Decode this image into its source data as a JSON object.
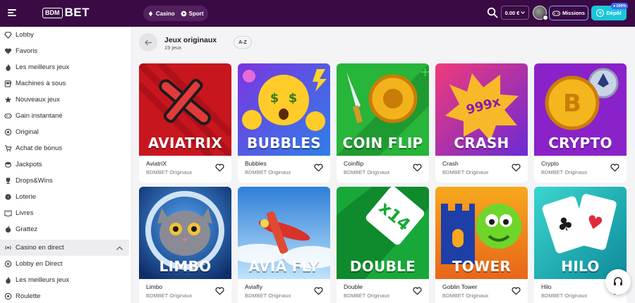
{
  "header": {
    "logo_box": "BDM",
    "logo_text": "BET",
    "switcher": [
      {
        "label": "Casino",
        "icon": "cards-icon"
      },
      {
        "label": "Sport",
        "icon": "soccer-ball-icon"
      }
    ],
    "balance": "0.00 €",
    "missions_label": "Missions",
    "deposit_label": "Dépôt",
    "deposit_badge": "100%",
    "colors": {
      "topbar": "#3a0a45",
      "deposit": "#19c7d9",
      "missions_border": "#8aa2ff"
    }
  },
  "sidebar": {
    "items": [
      {
        "label": "Lobby",
        "icon": "diamond-icon"
      },
      {
        "label": "Favoris",
        "icon": "heart-icon"
      },
      {
        "label": "Les meilleurs jeux",
        "icon": "fire-icon"
      },
      {
        "label": "Machines à sous",
        "icon": "slot-machine-icon"
      },
      {
        "label": "Nouveaux jeux",
        "icon": "star-icon"
      },
      {
        "label": "Gain instantané",
        "icon": "gamepad-icon"
      },
      {
        "label": "Original",
        "icon": "badge-icon"
      },
      {
        "label": "Achat de bonus",
        "icon": "cart-icon"
      },
      {
        "label": "Jackpots",
        "icon": "coins-icon"
      },
      {
        "label": "Drops&Wins",
        "icon": "trophy-icon"
      },
      {
        "label": "Loterie",
        "icon": "lottery-icon"
      },
      {
        "label": "Livres",
        "icon": "book-icon"
      },
      {
        "label": "Grattez",
        "icon": "scratch-icon"
      }
    ],
    "section": {
      "label": "Casino en direct",
      "icon": "live-icon"
    },
    "live_items": [
      {
        "label": "Lobby en Direct",
        "icon": "chip-icon"
      },
      {
        "label": "Les meilleurs jeux",
        "icon": "fire-icon"
      },
      {
        "label": "Roulette",
        "icon": "roulette-icon"
      }
    ]
  },
  "main": {
    "title": "Jeux originaux",
    "subtitle": "19 jeux",
    "sort_label": "A-Z",
    "games": [
      {
        "thumb_label": "AVIATRIX",
        "name": "AviatriX",
        "provider": "BDMBET Originaux",
        "bg": "#c8161f",
        "bg2": "#8c0a12"
      },
      {
        "thumb_label": "BUBBLES",
        "name": "Bubbles",
        "provider": "BDMBET Originaux",
        "bg": "#6a3be0",
        "bg2": "#2a7de8"
      },
      {
        "thumb_label": "COIN FLIP",
        "name": "Coinflip",
        "provider": "BDMBET Originaux",
        "bg": "#27b53a",
        "bg2": "#12862a"
      },
      {
        "thumb_label": "CRASH",
        "name": "Crash",
        "provider": "BDMBET Originaux",
        "bg": "#e2207c",
        "bg2": "#7a2ad6"
      },
      {
        "thumb_label": "CRYPTO",
        "name": "Crypto",
        "provider": "BDMBET Originaux",
        "bg": "#8a22c9",
        "bg2": "#4a1a8a"
      },
      {
        "thumb_label": "LIMBO",
        "name": "Limbo",
        "provider": "BDMBET Originaux",
        "bg": "#2c7fe0",
        "bg2": "#123f8a"
      },
      {
        "thumb_label": "AVIA FLY",
        "name": "Aviafly",
        "provider": "BDMBET Originaux",
        "bg": "#3f8ee6",
        "bg2": "#9fd0f5"
      },
      {
        "thumb_label": "DOUBLE",
        "name": "Double",
        "provider": "BDMBET Originaux",
        "bg": "#18a83a",
        "bg2": "#0e7a27"
      },
      {
        "thumb_label": "TOWER",
        "name": "Goblin Tower",
        "provider": "BDMBET Originaux",
        "bg": "#f29a16",
        "bg2": "#e0601a"
      },
      {
        "thumb_label": "HILO",
        "name": "Hilo",
        "provider": "BDMBET Originaux",
        "bg": "#1ec3c0",
        "bg2": "#0e8a9a"
      }
    ]
  }
}
